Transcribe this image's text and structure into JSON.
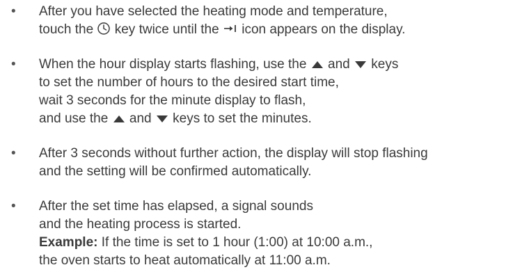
{
  "bullet_char": "•",
  "instructions": [
    {
      "lines": [
        {
          "text": "After you have selected the heating mode and temperature,"
        },
        {
          "pre": "touch the ",
          "mid": " key twice until the ",
          "post": " icon appears on the display.",
          "icon1": "clock-icon",
          "icon2": "timer-start-icon"
        }
      ]
    },
    {
      "lines": [
        {
          "pre": "When the hour display starts flashing, use the ",
          "mid": " and ",
          "post": " keys",
          "icon1": "up-triangle-icon",
          "icon2": "down-triangle-icon"
        },
        {
          "text": "to set the number of hours to the desired start time,"
        },
        {
          "text": "wait 3 seconds for the minute display to flash,"
        },
        {
          "pre": "and use the ",
          "mid": " and ",
          "post": " keys to set the minutes.",
          "icon1": "up-triangle-icon",
          "icon2": "down-triangle-icon"
        }
      ]
    },
    {
      "lines": [
        {
          "text": "After 3 seconds without further action, the display will stop flashing"
        },
        {
          "text": "and the setting will be confirmed automatically."
        }
      ]
    },
    {
      "lines": [
        {
          "text": "After the set time has elapsed, a signal sounds"
        },
        {
          "text": "and the heating process is started."
        },
        {
          "bold": "Example:",
          "text": " If the time is set to 1 hour (1:00) at 10:00 a.m.,"
        },
        {
          "text": "the oven starts to heat automatically at 11:00 a.m."
        }
      ]
    }
  ]
}
